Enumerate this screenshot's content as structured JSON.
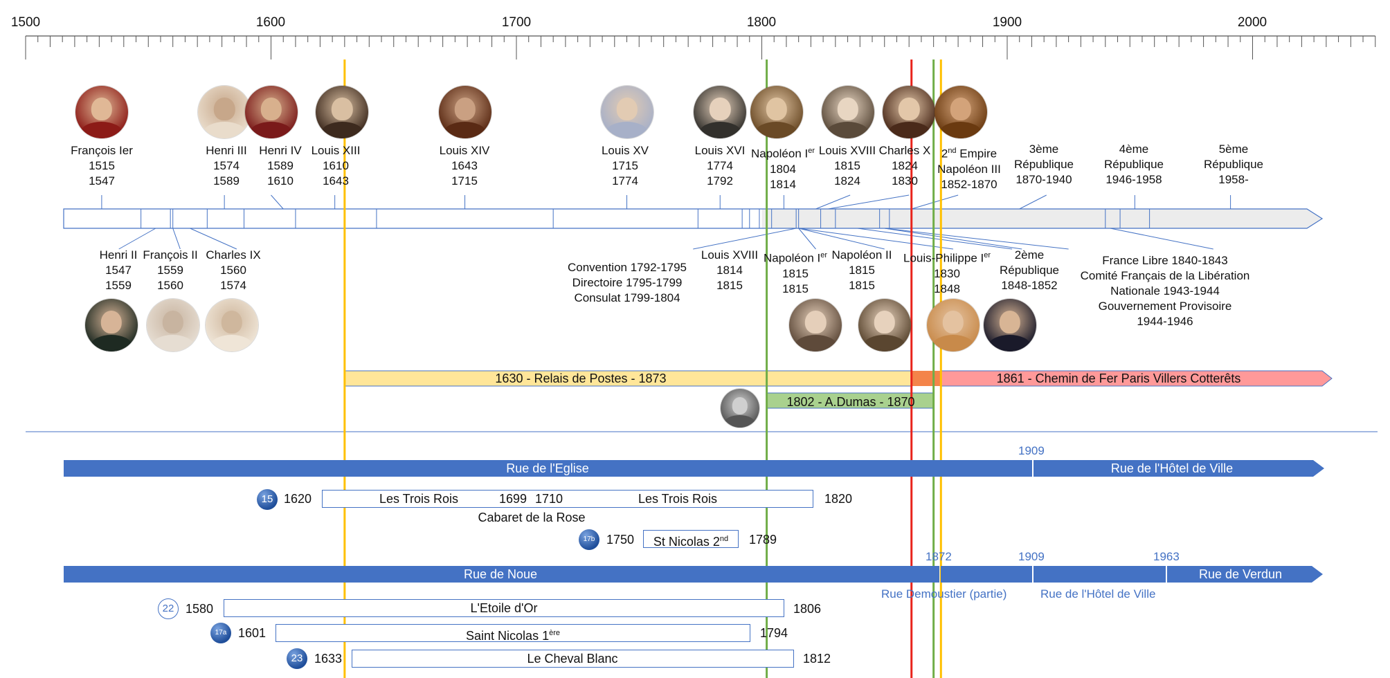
{
  "axis": {
    "ticks": [
      {
        "year": 1500,
        "label": "1500"
      },
      {
        "year": 1600,
        "label": "1600"
      },
      {
        "year": 1700,
        "label": "1700"
      },
      {
        "year": 1800,
        "label": "1800"
      },
      {
        "year": 1900,
        "label": "1900"
      },
      {
        "year": 2000,
        "label": "2000"
      }
    ],
    "min": 1500,
    "max": 2050
  },
  "monarchs_top": [
    {
      "name": "François Ier",
      "l2": "1515",
      "l3": "1547",
      "year": 1531
    },
    {
      "name": "Henri III",
      "l2": "1574",
      "l3": "1589",
      "year": 1581
    },
    {
      "name": "Henri IV",
      "l2": "1589",
      "l3": "1610",
      "year": 1600
    },
    {
      "name": "Louis XIII",
      "l2": "1610",
      "l3": "1643",
      "year": 1626
    },
    {
      "name": "Louis XIV",
      "l2": "1643",
      "l3": "1715",
      "year": 1679
    },
    {
      "name": "Louis XV",
      "l2": "1715",
      "l3": "1774",
      "year": 1745
    },
    {
      "name": "Louis XVI",
      "l2": "1774",
      "l3": "1792",
      "year": 1783
    },
    {
      "name": "Napoléon I",
      "name_sup": "er",
      "l2": "1804",
      "l3": "1814",
      "year": 1810
    },
    {
      "name": "Louis XVIII",
      "l2": "1815",
      "l3": "1824",
      "year": 1836
    },
    {
      "name": "Charles X",
      "l2": "1824",
      "l3": "1830",
      "year": 1860
    },
    {
      "name_pre": "2",
      "name_sup": "nd",
      "name": " Empire",
      "l2": "Napoléon III",
      "l3": "1852-1870",
      "year": 1880
    }
  ],
  "republics_top": [
    {
      "l1": "3ème",
      "l2": "République",
      "l3": "1870-1940",
      "year": 1916
    },
    {
      "l1": "4ème",
      "l2": "République",
      "l3": "1946-1958",
      "year": 1952
    },
    {
      "l1": "5ème",
      "l2": "République",
      "l3": "1958-",
      "year": 1991
    }
  ],
  "monarchs_bottom": [
    {
      "name": "Henri II",
      "l2": "1547",
      "l3": "1559",
      "year": 1538
    },
    {
      "name": "François II",
      "l2": "1559",
      "l3": "1560",
      "year": 1563
    },
    {
      "name": "Charles IX",
      "l2": "1560",
      "l3": "1574",
      "year": 1586
    },
    {
      "name": "Louis XVIII",
      "l2": "1814",
      "l3": "1815",
      "year": 1822
    },
    {
      "name": "Napoléon I",
      "name_sup": "er",
      "l2": "1815",
      "l3": "1815",
      "year": 1850
    },
    {
      "name": "Napoléon II",
      "l2": "1815",
      "l3": "1815",
      "year": 1878
    },
    {
      "name": "Louis-Philippe I",
      "name_sup": "er",
      "l2": "1830",
      "l3": "1848",
      "year": 1902
    }
  ],
  "convention": [
    "Convention 1792-1795",
    "Directoire 1795-1799",
    "Consulat 1799-1804"
  ],
  "republic2": [
    "2ème",
    "République",
    "1848-1852"
  ],
  "france_libre": [
    "France Libre 1840-1843",
    "Comité Français de la Libération",
    "Nationale 1943-1944",
    "Gouvernement Provisoire",
    "1944-1946"
  ],
  "spans": {
    "relais": "1630 - Relais de Postes - 1873",
    "chemin": "1861 - Chemin de Fer Paris  Villers Cotterêts",
    "dumas": "1802 - A.Dumas - 1870"
  },
  "streets": {
    "eglise": {
      "name1": "Rue de l'Eglise",
      "year": "1909",
      "name2": "Rue de l'Hôtel de Ville"
    },
    "noue": {
      "name1": "Rue de Noue",
      "y1": "1872",
      "y2": "1909",
      "y3": "1963",
      "name4": "Rue de Verdun",
      "sub1": "Rue Demoustier (partie)",
      "sub2": "Rue de l'Hôtel de Ville"
    }
  },
  "properties": [
    {
      "badge": "15",
      "start": "1620",
      "name": "Les Trois Rois",
      "mid1": "1699",
      "mid2": "1710",
      "name2": "Les Trois Rois",
      "end": "1820",
      "sub": "Cabaret de la Rose"
    },
    {
      "badge": "17b",
      "start": "1750",
      "name": "St Nicolas 2",
      "name_sup": "nd",
      "end": "1789"
    },
    {
      "badge": "22",
      "start": "1580",
      "name": "L'Etoile d'Or",
      "end": "1806"
    },
    {
      "badge": "17a",
      "start": "1601",
      "name": "Saint Nicolas 1",
      "name_sup": "ère",
      "end": "1794"
    },
    {
      "badge": "23",
      "start": "1633",
      "name": "Le Cheval Blanc",
      "end": "1812"
    }
  ],
  "colors": {
    "blue": "#4472c4",
    "yellow": "#ffc000",
    "green": "#70ad47",
    "red": "#e8231b",
    "relais_fill": "#ffe699",
    "chemin_fill": "#ff9999",
    "dumas_fill": "#a9d18e",
    "overlap_fill": "#f4844a",
    "gray_fill": "#ececec"
  },
  "portraits": [
    {
      "icon": "portrait-francois-ier-icon",
      "year": 1531,
      "row": "top",
      "c1": "#8c1b17",
      "c2": "#e0b896"
    },
    {
      "icon": "portrait-henri-iii-icon",
      "year": 1581,
      "row": "top",
      "c1": "#e9dccb",
      "c2": "#c7a78a"
    },
    {
      "icon": "portrait-henri-iv-icon",
      "year": 1600,
      "row": "top",
      "c1": "#7a1a1a",
      "c2": "#d8b08d"
    },
    {
      "icon": "portrait-louis-xiii-icon",
      "year": 1629,
      "row": "top",
      "c1": "#3d2a1e",
      "c2": "#d9bfa2"
    },
    {
      "icon": "portrait-louis-xiv-icon",
      "year": 1679,
      "row": "top",
      "c1": "#5a2a14",
      "c2": "#caa082"
    },
    {
      "icon": "portrait-louis-xv-icon",
      "year": 1745,
      "row": "top",
      "c1": "#a7b0c8",
      "c2": "#e2cbb3"
    },
    {
      "icon": "portrait-louis-xvi-icon",
      "year": 1783,
      "row": "top",
      "c1": "#32302c",
      "c2": "#e6d1bc"
    },
    {
      "icon": "portrait-napoleon-ier-icon",
      "year": 1806,
      "row": "top",
      "c1": "#6a4a26",
      "c2": "#e0c4a2"
    },
    {
      "icon": "portrait-louis-xviii-icon",
      "year": 1835,
      "row": "top",
      "c1": "#5a4a3a",
      "c2": "#e8d6c2"
    },
    {
      "icon": "portrait-charles-x-icon",
      "year": 1860,
      "row": "top",
      "c1": "#4a2a1a",
      "c2": "#e3c7a9"
    },
    {
      "icon": "portrait-napoleon-iii-icon",
      "year": 1881,
      "row": "top",
      "c1": "#6a3a10",
      "c2": "#d3a37a"
    },
    {
      "icon": "portrait-henri-ii-icon",
      "year": 1535,
      "row": "bottom",
      "c1": "#1e2a22",
      "c2": "#d7b497"
    },
    {
      "icon": "portrait-francois-ii-icon",
      "year": 1560,
      "row": "bottom",
      "c1": "#e6ddd2",
      "c2": "#c8b4a0"
    },
    {
      "icon": "portrait-charles-ix-icon",
      "year": 1584,
      "row": "bottom",
      "c1": "#efe5d7",
      "c2": "#cfb79d"
    },
    {
      "icon": "portrait-louis-xviii-b-icon",
      "year": 1822,
      "row": "bottom",
      "c1": "#5e4a3a",
      "c2": "#e5cfba"
    },
    {
      "icon": "portrait-napoleon-ier-b-icon",
      "year": 1850,
      "row": "bottom",
      "c1": "#5a4630",
      "c2": "#e7d2bd"
    },
    {
      "icon": "portrait-napoleon-ii-icon",
      "year": 1878,
      "row": "bottom",
      "c1": "#c88a4a",
      "c2": "#e4c2a0"
    },
    {
      "icon": "portrait-louis-philippe-icon",
      "year": 1901,
      "row": "bottom",
      "c1": "#1a1a2a",
      "c2": "#d8b595"
    },
    {
      "icon": "portrait-dumas-icon",
      "year": 1791,
      "row": "dumas",
      "c1": "#555555",
      "c2": "#cfcfcf"
    }
  ]
}
